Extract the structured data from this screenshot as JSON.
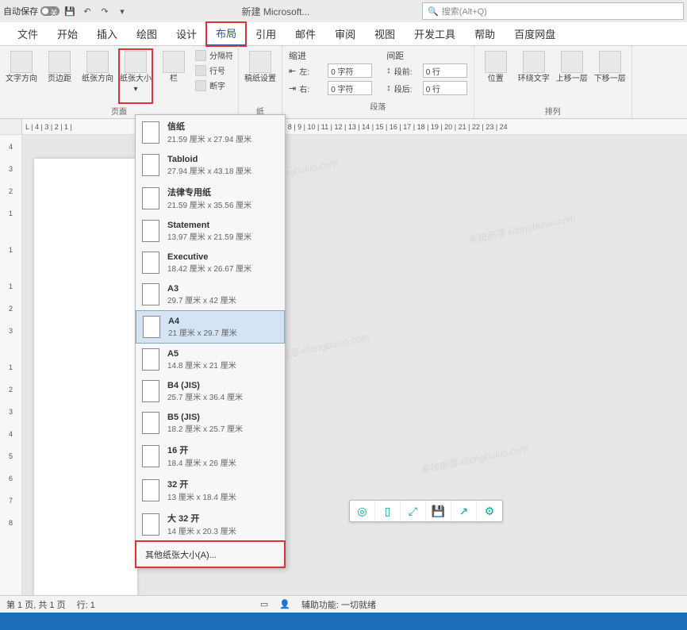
{
  "titlebar": {
    "autosave_label": "自动保存",
    "autosave_state": "关",
    "doc_title": "新建 Microsoft...",
    "search_placeholder": "搜索(Alt+Q)"
  },
  "tabs": {
    "file": "文件",
    "home": "开始",
    "insert": "插入",
    "draw": "绘图",
    "design": "设计",
    "layout": "布局",
    "references": "引用",
    "mail": "邮件",
    "review": "审阅",
    "view": "视图",
    "dev": "开发工具",
    "help": "帮助",
    "baidu": "百度网盘"
  },
  "ribbon": {
    "text_dir": "文字方向",
    "margins": "页边距",
    "orientation": "纸张方向",
    "size": "纸张大小",
    "columns": "栏",
    "breaks": "分隔符",
    "lines": "行号",
    "hyphen": "断字",
    "draft": "稿纸设置",
    "page_setup_group": "页面",
    "draft_group": "纸",
    "indent_head": "缩进",
    "spacing_head": "间距",
    "indent_left": "左:",
    "indent_right": "右:",
    "indent_l_val": "0 字符",
    "indent_r_val": "0 字符",
    "sp_before": "段前:",
    "sp_after": "段后:",
    "sp_b_val": "0 行",
    "sp_a_val": "0 行",
    "paragraph_group": "段落",
    "position": "位置",
    "wrap": "环绕文字",
    "bring": "上移一层",
    "send": "下移一层",
    "arrange_group": "排列"
  },
  "paper_sizes": [
    {
      "name": "信纸",
      "dim": "21.59 厘米 x 27.94 厘米"
    },
    {
      "name": "Tabloid",
      "dim": "27.94 厘米 x 43.18 厘米"
    },
    {
      "name": "法律专用纸",
      "dim": "21.59 厘米 x 35.56 厘米"
    },
    {
      "name": "Statement",
      "dim": "13.97 厘米 x 21.59 厘米"
    },
    {
      "name": "Executive",
      "dim": "18.42 厘米 x 26.67 厘米"
    },
    {
      "name": "A3",
      "dim": "29.7 厘米 x 42 厘米"
    },
    {
      "name": "A4",
      "dim": "21 厘米 x 29.7 厘米"
    },
    {
      "name": "A5",
      "dim": "14.8 厘米 x 21 厘米"
    },
    {
      "name": "B4 (JIS)",
      "dim": "25.7 厘米 x 36.4 厘米"
    },
    {
      "name": "B5 (JIS)",
      "dim": "18.2 厘米 x 25.7 厘米"
    },
    {
      "name": "16 开",
      "dim": "18.4 厘米 x 26 厘米"
    },
    {
      "name": "32 开",
      "dim": "13 厘米 x 18.4 厘米"
    },
    {
      "name": "大 32 开",
      "dim": "14 厘米 x 20.3 厘米"
    }
  ],
  "more_paper": "其他纸张大小(A)...",
  "hruler_left": "L | 4 | 3 | 2 | 1 |",
  "hruler_right": "| 5 | 6 | 7 | 8 | 9 | 10 | 11 | 12 | 13 | 14 | 15 | 16 | 17 | 18 | 19 | 20 | 21 | 22 | 23 | 24",
  "vruler": [
    "4",
    "3",
    "2",
    "1",
    "",
    "1",
    "",
    "1",
    "2",
    "3",
    "",
    "1",
    "2",
    "3",
    "4",
    "5",
    "6",
    "7",
    "8"
  ],
  "status": {
    "page": "第 1 页, 共 1 页",
    "line": "行: 1",
    "a11y": "辅助功能: 一切就绪"
  },
  "watermark": "系统部落 xitongbuluo.com"
}
